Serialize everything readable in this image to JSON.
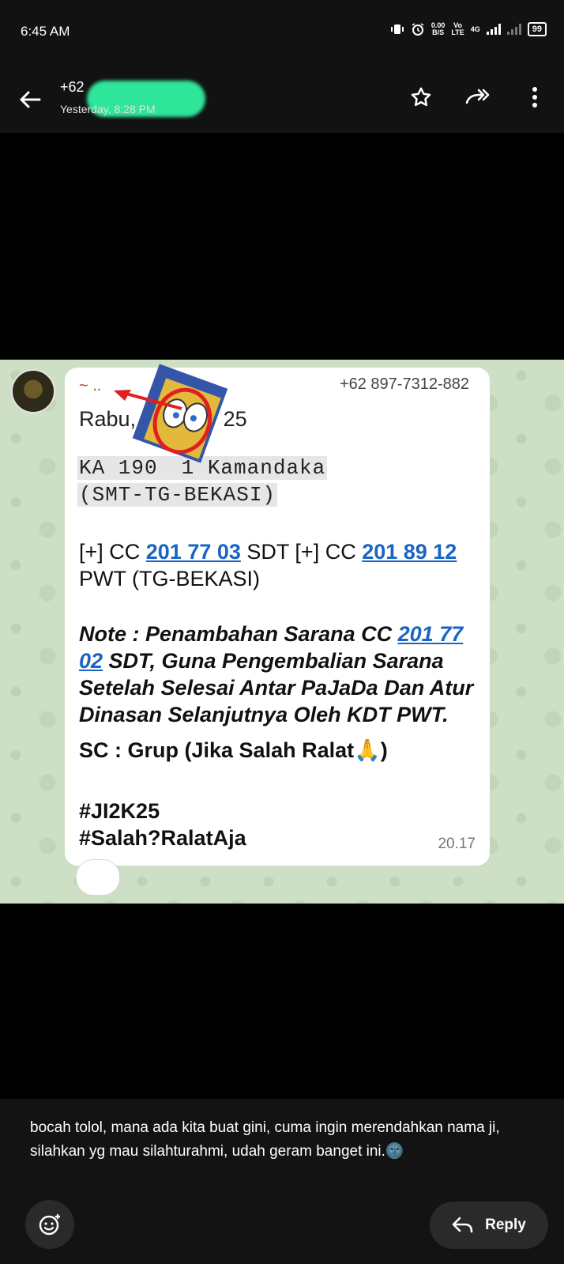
{
  "status_bar": {
    "time": "6:45 AM",
    "speed": "0.00",
    "speed_unit": "B/S",
    "volte_top": "Vo",
    "volte_bottom": "LTE",
    "network": "4G",
    "battery": "99"
  },
  "app_bar": {
    "sender": "+62",
    "subtitle": "Yesterday, 8:28 PM",
    "icons": [
      "back-arrow-icon",
      "star-icon",
      "forward-icon",
      "more-vert-icon"
    ]
  },
  "photo": {
    "message": {
      "tilde": "~ ..",
      "phone": "+62 897-7312-882",
      "date_left": "Rabu, 3",
      "date_right": "25",
      "code_line1_a": "KA 190",
      "code_line1_b": "1  Kamandaka",
      "code_line2": "(SMT-TG-BEKASI)",
      "cc_prefix": "[+] CC ",
      "cc_link1": "201 77 03",
      "cc_mid": " SDT [+] CC ",
      "cc_link2": "201 89 12",
      "pwt_line": "PWT (TG-BEKASI)",
      "note_prefix": "Note : Penambahan Sarana CC ",
      "note_link_a": "201 77",
      "note_link_b": "02",
      "note_line2_rest": " SDT, Guna Pengembalian Sarana",
      "note_line3": "Setelah Selesai Antar PaJaDa Dan Atur",
      "note_line4": "Dinasan Selanjutnya Oleh KDT PWT.",
      "sc_line": "SC : Grup (Jika Salah Ralat",
      "sc_emoji": "🙏",
      "sc_close": ")",
      "hashtag1": "#JI2K25",
      "hashtag2": "#Salah?RalatAja",
      "timestamp": "20.17"
    },
    "reaction": "😂"
  },
  "caption": {
    "text": "bocah tolol, mana ada kita buat gini, cuma ingin merendahkan nama ji, silahkan yg mau silahturahmi, udah geram banget ini.🌚"
  },
  "bottom_bar": {
    "reply_label": "Reply"
  }
}
